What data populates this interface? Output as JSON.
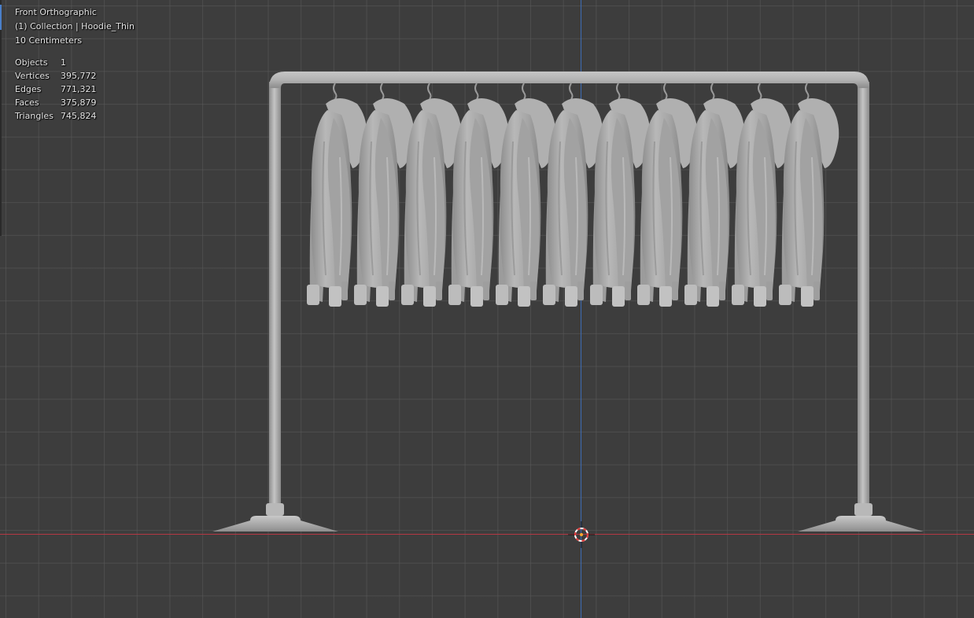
{
  "viewport": {
    "view_name": "Front Orthographic",
    "collection_line": "(1) Collection | Hoodie_Thin",
    "scale": "10 Centimeters"
  },
  "stats": [
    {
      "label": "Objects",
      "value": "1"
    },
    {
      "label": "Vertices",
      "value": "395,772"
    },
    {
      "label": "Edges",
      "value": "771,321"
    },
    {
      "label": "Faces",
      "value": "375,879"
    },
    {
      "label": "Triangles",
      "value": "745,824"
    }
  ],
  "colors": {
    "background": "#3d3d3d",
    "grid": "#5a5a5a",
    "x_axis": "#b53744",
    "z_axis": "#3d6cb5",
    "mesh": "#a8a8a8",
    "cursor_red": "#e03a3a"
  },
  "scene": {
    "hoodie_count": 11
  }
}
